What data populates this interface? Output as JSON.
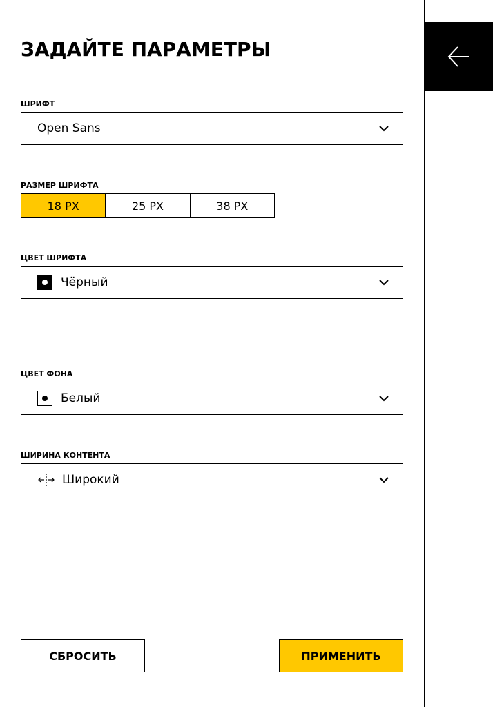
{
  "panel": {
    "title": "ЗАДАЙТЕ ПАРАМЕТРЫ",
    "back_icon": "arrow-left-icon"
  },
  "font": {
    "label": "ШРИФТ",
    "value": "Open Sans",
    "icon": "chevron-down-icon"
  },
  "font_size": {
    "label": "РАЗМЕР ШРИФТА",
    "options": [
      "18 PX",
      "25 PX",
      "38 PX"
    ],
    "selected": "18 PX"
  },
  "font_color": {
    "label": "ЦВЕТ ШРИФТА",
    "value": "Чёрный",
    "swatch_color": "#000000"
  },
  "bg_color": {
    "label": "ЦВЕТ ФОНА",
    "value": "Белый",
    "swatch_color": "#ffffff"
  },
  "content_width": {
    "label": "ШИРИНА КОНТЕНТА",
    "value": "Широкий",
    "icon": "width-expand-icon"
  },
  "actions": {
    "reset_label": "СБРОСИТЬ",
    "apply_label": "ПРИМЕНИТЬ"
  },
  "colors": {
    "accent": "#ffc800",
    "border": "#000000",
    "divider": "#e0e0e0"
  }
}
